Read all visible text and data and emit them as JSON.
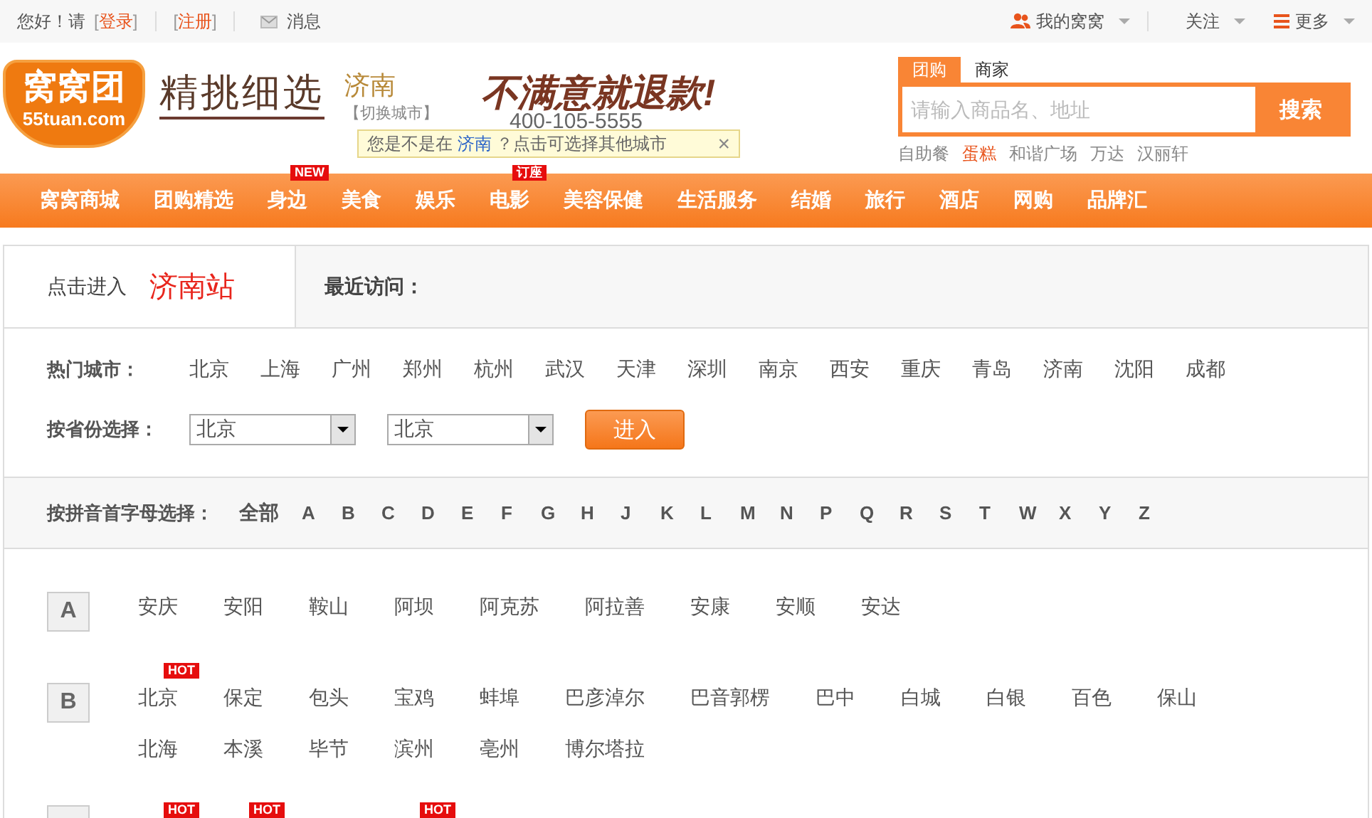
{
  "top_bar": {
    "greeting": "您好！请",
    "login": {
      "open": "[",
      "label": "登录",
      "close": "]"
    },
    "register": {
      "open": "[",
      "label": "注册",
      "close": "]"
    },
    "messages": "消息",
    "account": "我的窝窝",
    "follow": "关注",
    "more": "更多"
  },
  "header": {
    "logo_name": "窝窝团",
    "logo_domain": "55tuan.com",
    "slogan": "精挑细选",
    "city": "济南",
    "switch_city": "【切换城市】",
    "promise": "不满意就退款!",
    "phone": "400-105-5555",
    "tooltip": {
      "before": "您是不是在",
      "city": "济南",
      "after": "？点击可选择其他城市",
      "close": "×"
    },
    "search": {
      "tabs": [
        {
          "label": "团购",
          "selected": true
        },
        {
          "label": "商家",
          "selected": false
        }
      ],
      "placeholder": "请输入商品名、地址",
      "button": "搜索",
      "hot_words": [
        {
          "label": "自助餐",
          "highlight": false
        },
        {
          "label": "蛋糕",
          "highlight": true
        },
        {
          "label": "和谐广场",
          "highlight": false
        },
        {
          "label": "万达",
          "highlight": false
        },
        {
          "label": "汉丽轩",
          "highlight": false
        }
      ]
    }
  },
  "nav": [
    {
      "label": "窝窝商城"
    },
    {
      "label": "团购精选"
    },
    {
      "label": "身边",
      "badge": "NEW"
    },
    {
      "label": "美食"
    },
    {
      "label": "娱乐"
    },
    {
      "label": "电影",
      "badge": "订座"
    },
    {
      "label": "美容保健"
    },
    {
      "label": "生活服务"
    },
    {
      "label": "结婚"
    },
    {
      "label": "旅行"
    },
    {
      "label": "酒店"
    },
    {
      "label": "网购"
    },
    {
      "label": "品牌汇"
    }
  ],
  "entry": {
    "prefix": "点击进入",
    "station": "济南站",
    "recent_label": "最近访问："
  },
  "hot_cities": {
    "label": "热门城市：",
    "cities": [
      "北京",
      "上海",
      "广州",
      "郑州",
      "杭州",
      "武汉",
      "天津",
      "深圳",
      "南京",
      "西安",
      "重庆",
      "青岛",
      "济南",
      "沈阳",
      "成都"
    ]
  },
  "province_select": {
    "label": "按省份选择：",
    "province": "北京",
    "city": "北京",
    "button": "进入"
  },
  "letters": {
    "label": "按拼音首字母选择：",
    "all": "全部",
    "items": [
      "A",
      "B",
      "C",
      "D",
      "E",
      "F",
      "G",
      "H",
      "J",
      "K",
      "L",
      "M",
      "N",
      "P",
      "Q",
      "R",
      "S",
      "T",
      "W",
      "X",
      "Y",
      "Z"
    ]
  },
  "groups": [
    {
      "letter": "A",
      "cities": [
        {
          "name": "安庆"
        },
        {
          "name": "安阳"
        },
        {
          "name": "鞍山"
        },
        {
          "name": "阿坝"
        },
        {
          "name": "阿克苏"
        },
        {
          "name": "阿拉善"
        },
        {
          "name": "安康"
        },
        {
          "name": "安顺"
        },
        {
          "name": "安达"
        }
      ]
    },
    {
      "letter": "B",
      "cities": [
        {
          "name": "北京",
          "badge": "HOT"
        },
        {
          "name": "保定"
        },
        {
          "name": "包头"
        },
        {
          "name": "宝鸡"
        },
        {
          "name": "蚌埠"
        },
        {
          "name": "巴彦淖尔"
        },
        {
          "name": "巴音郭楞"
        },
        {
          "name": "巴中"
        },
        {
          "name": "白城"
        },
        {
          "name": "白银"
        },
        {
          "name": "百色"
        },
        {
          "name": "保山"
        },
        {
          "name": "北海"
        },
        {
          "name": "本溪"
        },
        {
          "name": "毕节"
        },
        {
          "name": "滨州"
        },
        {
          "name": "亳州"
        },
        {
          "name": "博尔塔拉"
        }
      ]
    }
  ],
  "cut_badges": [
    {
      "hot": true,
      "badge": "HOT"
    },
    {
      "hot": true,
      "badge": "HOT"
    },
    {
      "hot": false
    },
    {
      "hot": true,
      "badge": "HOT"
    }
  ]
}
